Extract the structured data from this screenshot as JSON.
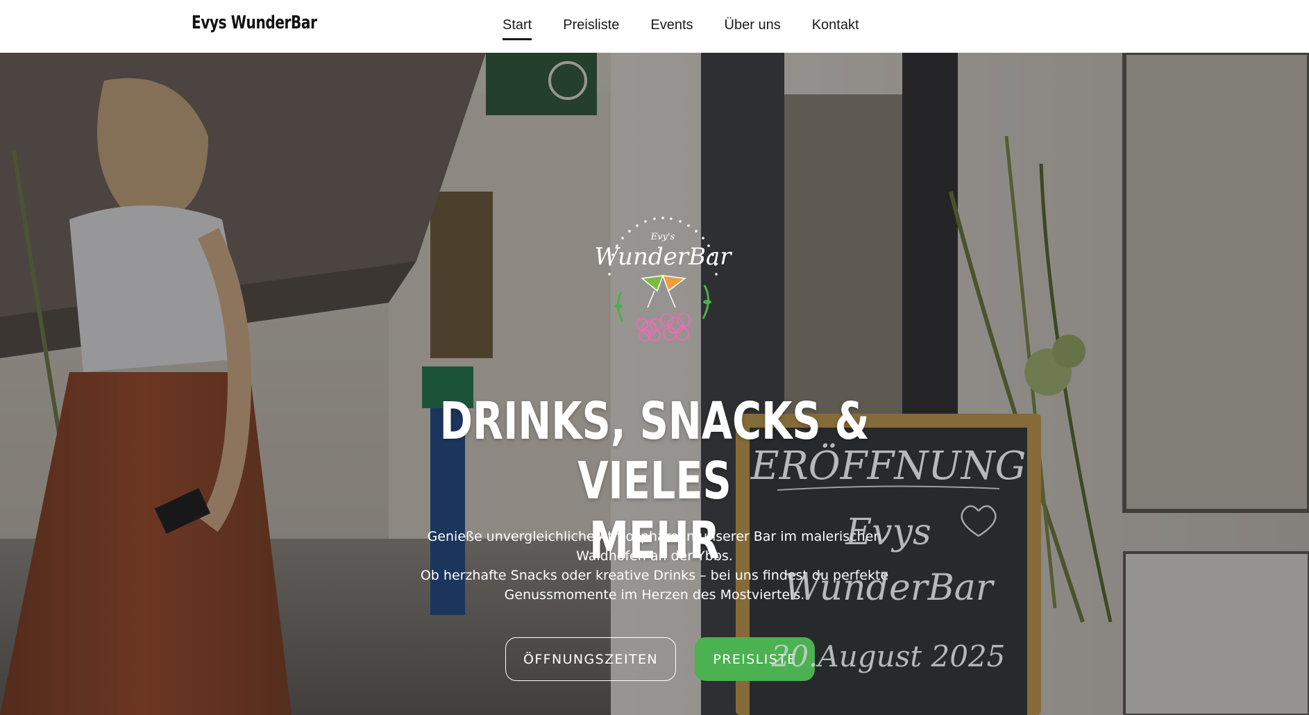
{
  "header": {
    "brand": "Evys WunderBar",
    "nav": [
      {
        "label": "Start",
        "active": true
      },
      {
        "label": "Preisliste",
        "active": false
      },
      {
        "label": "Events",
        "active": false
      },
      {
        "label": "Über uns",
        "active": false
      },
      {
        "label": "Kontakt",
        "active": false
      }
    ]
  },
  "hero": {
    "logo": {
      "script_small": "Evy's",
      "script_large": "WunderBar"
    },
    "headline_line1": "DRINKS, SNACKS & VIELES",
    "headline_line2": "MEHR",
    "paragraph1": "Genieße unvergleichliche Atmosphäre in unserer Bar im malerischen Waidhofen an der Ybbs.",
    "paragraph2": "Ob herzhafte Snacks oder kreative Drinks – bei uns findest du perfekte Genussmomente im Herzen des Mostviertels.",
    "buttons": {
      "hours_label": "ÖFFNUNGSZEITEN",
      "pricelist_label": "PREISLISTE"
    },
    "chalkboard": {
      "line1": "ERÖFFNUNG",
      "line2": "Evys",
      "line3": "WunderBar",
      "line4": "20.August 2025"
    }
  },
  "colors": {
    "accent_green": "#4cb151",
    "text_dark": "#1a1a1a",
    "overlay": "rgba(20,20,20,0.38)"
  }
}
